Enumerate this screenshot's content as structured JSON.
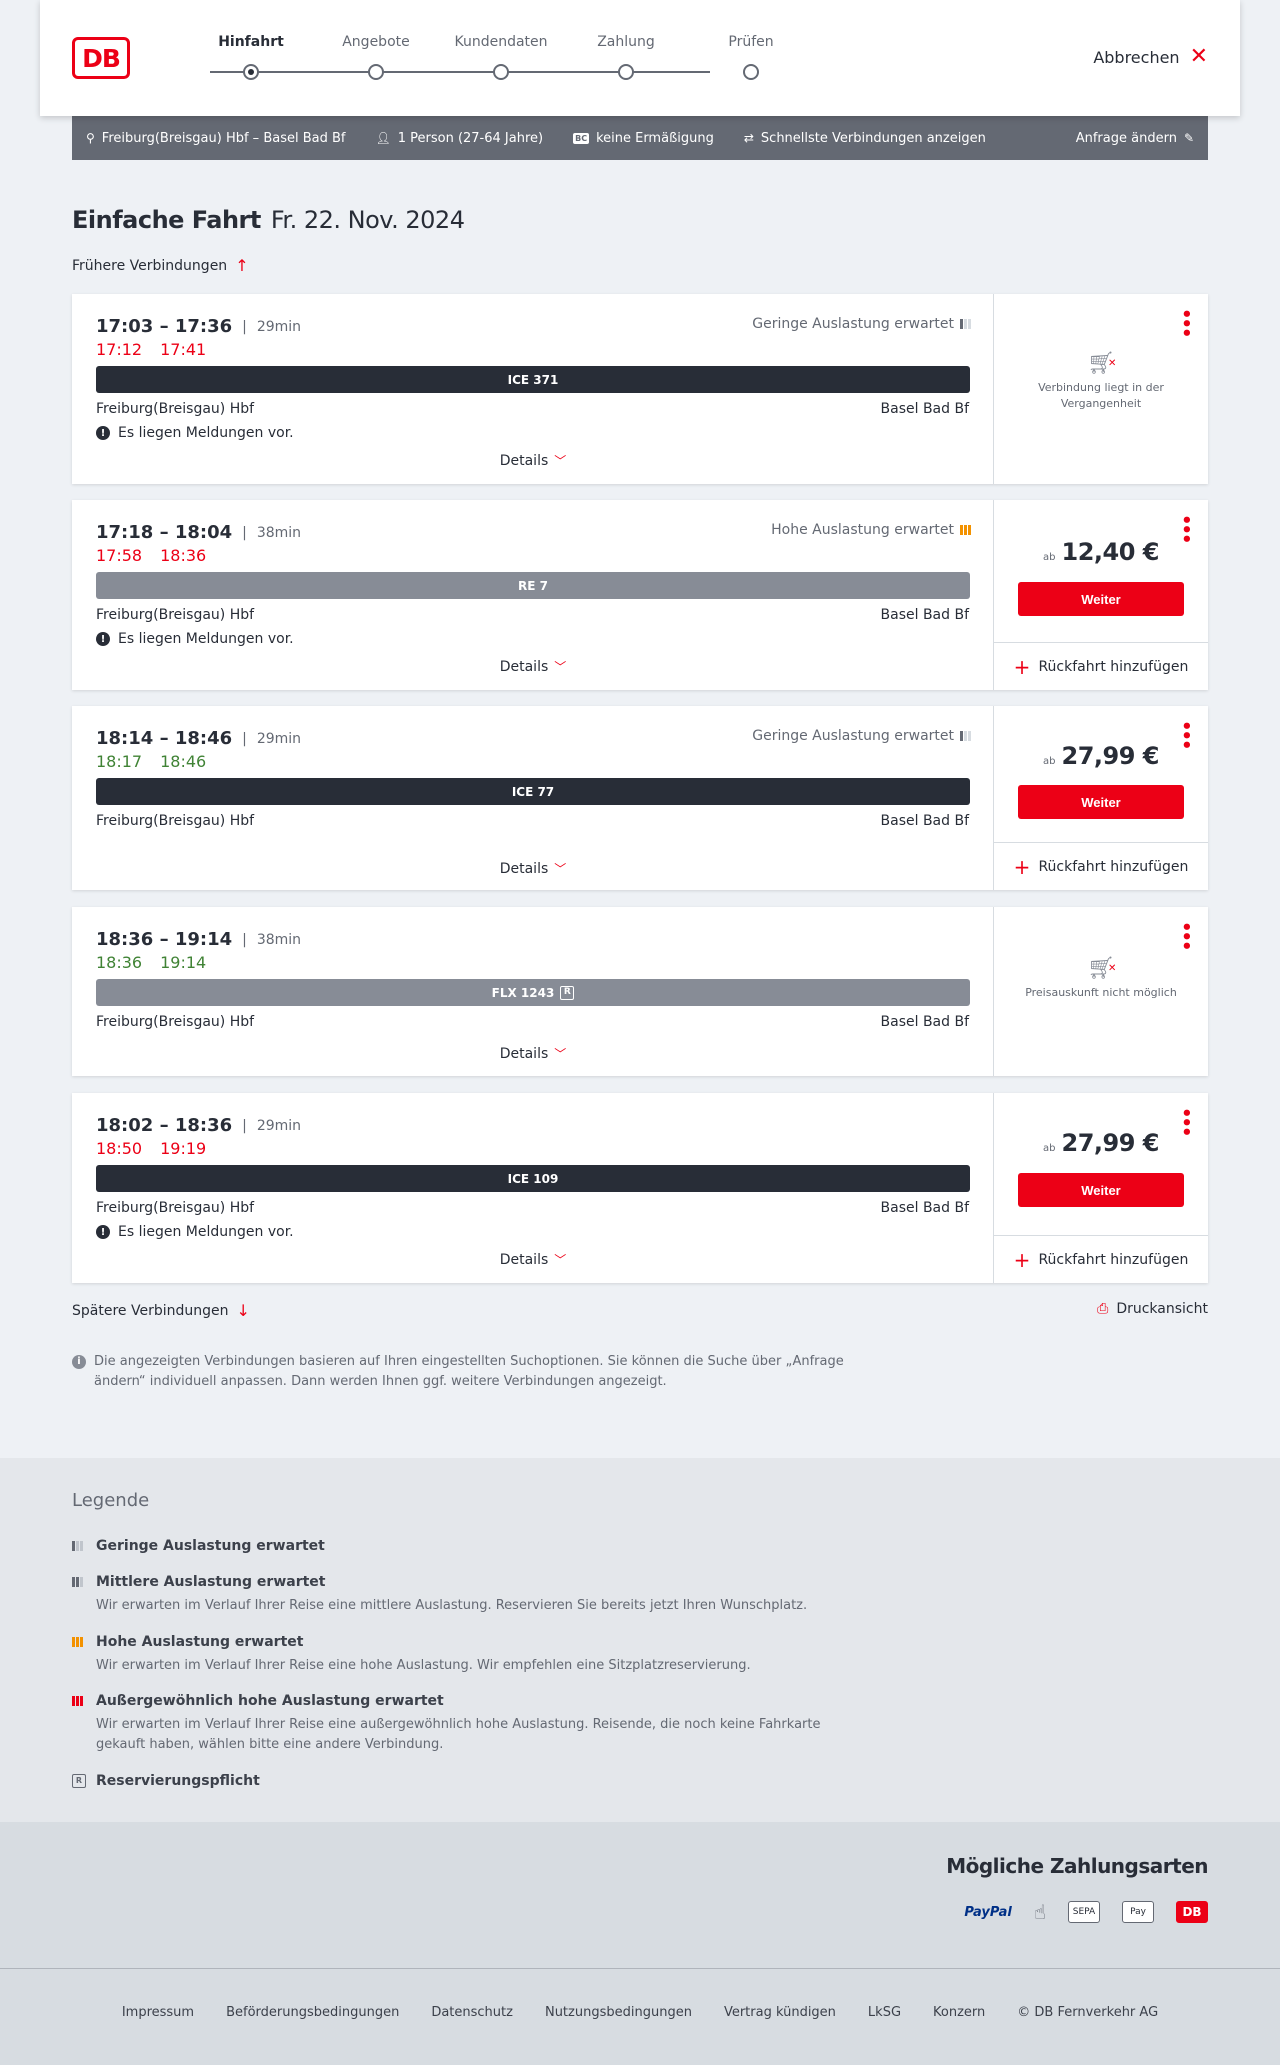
{
  "header": {
    "logo": "DB",
    "steps": [
      {
        "label": "Hinfahrt",
        "active": true
      },
      {
        "label": "Angebote",
        "active": false
      },
      {
        "label": "Kundendaten",
        "active": false
      },
      {
        "label": "Zahlung",
        "active": false
      },
      {
        "label": "Prüfen",
        "active": false
      }
    ],
    "cancel_label": "Abbrechen"
  },
  "infobar": {
    "route": "Freiburg(Breisgau) Hbf – Basel Bad Bf",
    "persons": "1 Person (27-64 Jahre)",
    "bc_badge": "BC",
    "discount": "keine Ermäßigung",
    "fastest": "Schnellste Verbindungen anzeigen",
    "edit": "Anfrage ändern"
  },
  "title": {
    "main": "Einfache Fahrt",
    "date": "Fr. 22. Nov. 2024"
  },
  "earlier": "Frühere Verbindungen",
  "later": "Spätere Verbindungen",
  "print": "Druckansicht",
  "connections": [
    {
      "times": "17:03 – 17:36",
      "duration": "29min",
      "rt_dep": "17:12",
      "rt_arr": "17:41",
      "rt_color": "red",
      "occupancy": "Geringe Auslastung erwartet",
      "occ_level": "low",
      "train": "ICE 371",
      "train_style": "dark",
      "reservation": false,
      "from": "Freiburg(Breisgau) Hbf",
      "to": "Basel Bad Bf",
      "message": "Es liegen Meldungen vor.",
      "details": "Details",
      "status": "Verbindung liegt in der Vergangenheit"
    },
    {
      "times": "17:18 – 18:04",
      "duration": "38min",
      "rt_dep": "17:58",
      "rt_arr": "18:36",
      "rt_color": "red",
      "occupancy": "Hohe Auslastung erwartet",
      "occ_level": "high",
      "train": "RE 7",
      "train_style": "grey",
      "reservation": false,
      "from": "Freiburg(Breisgau) Hbf",
      "to": "Basel Bad Bf",
      "message": "Es liegen Meldungen vor.",
      "details": "Details",
      "price_prefix": "ab",
      "price": "12,40 €",
      "button": "Weiter",
      "return": "Rückfahrt hinzufügen"
    },
    {
      "times": "18:14 – 18:46",
      "duration": "29min",
      "rt_dep": "18:17",
      "rt_arr": "18:46",
      "rt_color": "green",
      "occupancy": "Geringe Auslastung erwartet",
      "occ_level": "low",
      "train": "ICE 77",
      "train_style": "dark",
      "reservation": false,
      "from": "Freiburg(Breisgau) Hbf",
      "to": "Basel Bad Bf",
      "details": "Details",
      "price_prefix": "ab",
      "price": "27,99 €",
      "button": "Weiter",
      "return": "Rückfahrt hinzufügen"
    },
    {
      "times": "18:36 – 19:14",
      "duration": "38min",
      "rt_dep": "18:36",
      "rt_arr": "19:14",
      "rt_color": "green",
      "train": "FLX 1243",
      "train_style": "grey",
      "reservation": true,
      "reservation_badge": "R",
      "from": "Freiburg(Breisgau) Hbf",
      "to": "Basel Bad Bf",
      "details": "Details",
      "status": "Preisauskunft nicht möglich"
    },
    {
      "times": "18:02 – 18:36",
      "duration": "29min",
      "rt_dep": "18:50",
      "rt_arr": "19:19",
      "rt_color": "red",
      "train": "ICE 109",
      "train_style": "dark",
      "reservation": false,
      "from": "Freiburg(Breisgau) Hbf",
      "to": "Basel Bad Bf",
      "message": "Es liegen Meldungen vor.",
      "details": "Details",
      "price_prefix": "ab",
      "price": "27,99 €",
      "button": "Weiter",
      "return": "Rückfahrt hinzufügen"
    }
  ],
  "note": "Die angezeigten Verbindungen basieren auf Ihren eingestellten Suchoptionen. Sie können die Suche über „Anfrage ändern“ individuell anpassen. Dann werden Ihnen ggf. weitere Verbindungen angezeigt.",
  "legend": {
    "title": "Legende",
    "items": [
      {
        "title": "Geringe Auslastung erwartet",
        "desc": ""
      },
      {
        "title": "Mittlere Auslastung erwartet",
        "desc": "Wir erwarten im Verlauf Ihrer Reise eine mittlere Auslastung. Reservieren Sie bereits jetzt Ihren Wunschplatz."
      },
      {
        "title": "Hohe Auslastung erwartet",
        "desc": "Wir erwarten im Verlauf Ihrer Reise eine hohe Auslastung. Wir empfehlen eine Sitzplatzreservierung."
      },
      {
        "title": "Außergewöhnlich hohe Auslastung erwartet",
        "desc": "Wir erwarten im Verlauf Ihrer Reise eine außergewöhnlich hohe Auslastung. Reisende, die noch keine Fahrkarte gekauft haben, wählen bitte eine andere Verbindung."
      },
      {
        "title": "Reservierungspflicht",
        "desc": ""
      }
    ]
  },
  "payment": {
    "title": "Mögliche Zahlungsarten",
    "methods": [
      "PayPal",
      "card",
      "SEPA",
      "Pay",
      "DB"
    ]
  },
  "footer": {
    "links": [
      "Impressum",
      "Beförderungsbedingungen",
      "Datenschutz",
      "Nutzungsbedingungen",
      "Vertrag kündigen",
      "LkSG",
      "Konzern",
      "© DB Fernverkehr AG"
    ]
  },
  "colors": {
    "accent": "#ec0016",
    "delay": "#ec0016",
    "ontime": "#408335",
    "high_occupancy": "#f39200",
    "dark_train": "#282d37",
    "grey_train": "#878c96"
  }
}
